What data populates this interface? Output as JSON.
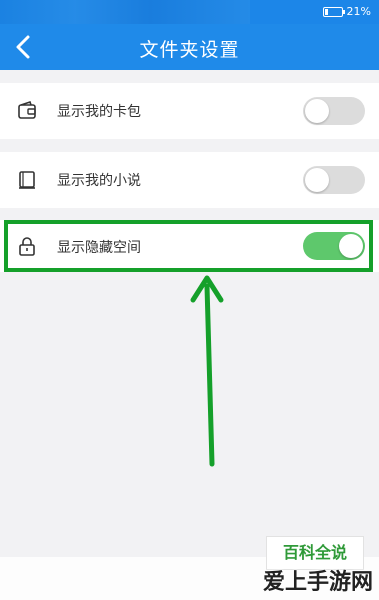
{
  "status": {
    "battery": "21%",
    "battery_level": 0.21
  },
  "header": {
    "title": "文件夹设置",
    "back_icon": "back-chevron-icon"
  },
  "settings": [
    {
      "label": "显示我的卡包",
      "icon": "wallet-icon",
      "enabled": false
    },
    {
      "label": "显示我的小说",
      "icon": "book-icon",
      "enabled": false
    },
    {
      "label": "显示隐藏空间",
      "icon": "lock-icon",
      "enabled": true
    }
  ],
  "annotation": {
    "highlight_color": "#15a02a",
    "arrow_color": "#15a02a"
  },
  "watermarks": {
    "baike": "百科全说",
    "site": "爱上手游网"
  },
  "colors": {
    "header": "#1f8ae9",
    "toggle_on": "#5ec86c",
    "toggle_off": "#dcdcdc"
  }
}
